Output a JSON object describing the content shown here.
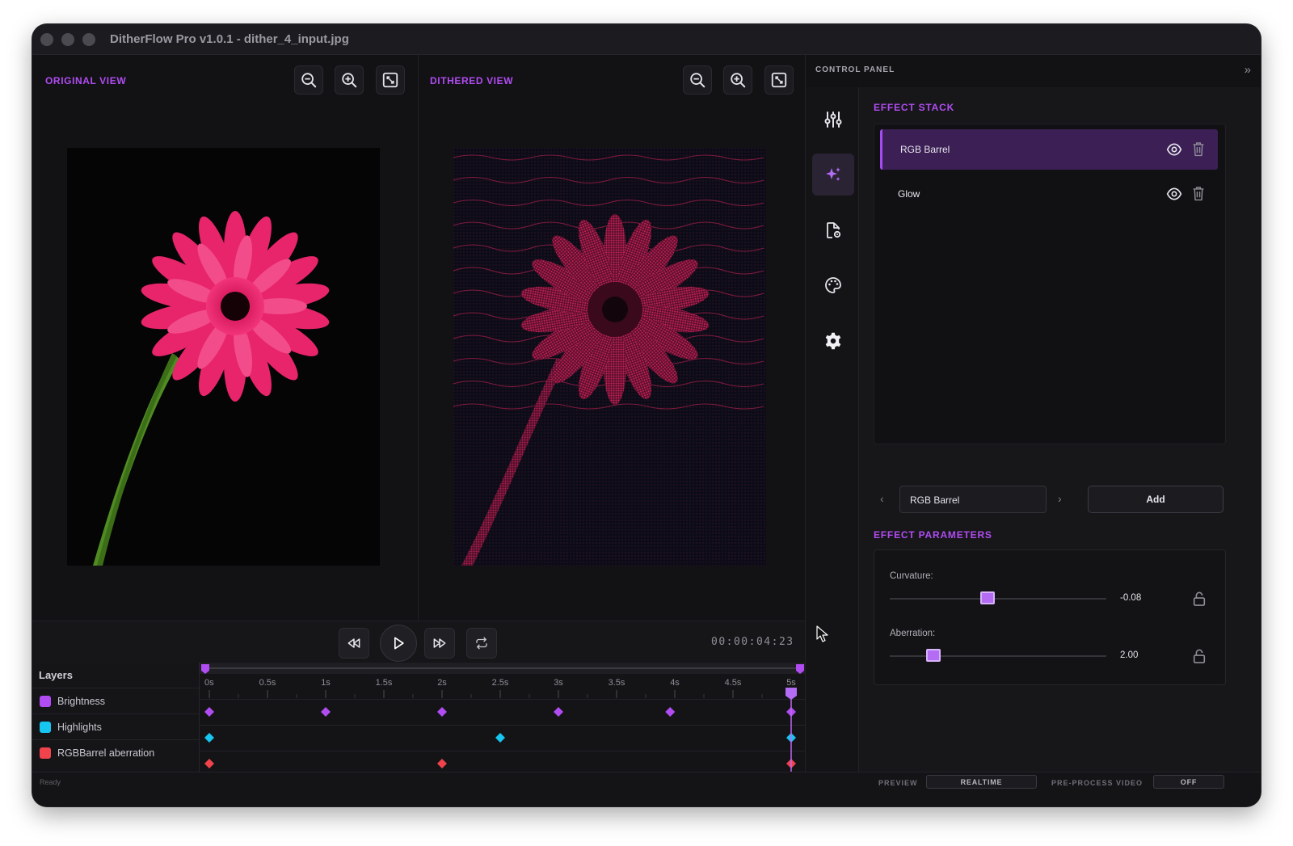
{
  "window": {
    "title": "DitherFlow Pro v1.0.1 - dither_4_input.jpg"
  },
  "views": {
    "original": {
      "title": "ORIGINAL VIEW"
    },
    "dithered": {
      "title": "DITHERED VIEW"
    }
  },
  "transport": {
    "timecode": "00:00:04:23"
  },
  "layers": {
    "title": "Layers",
    "items": [
      {
        "label": "Brightness",
        "color": "#b14cf2"
      },
      {
        "label": "Highlights",
        "color": "#17c6f0"
      },
      {
        "label": "RGBBarrel aberration",
        "color": "#f0434c"
      }
    ]
  },
  "timeline": {
    "ticks": [
      "0s",
      "0.5s",
      "1s",
      "1.5s",
      "2s",
      "2.5s",
      "3s",
      "3.5s",
      "4s",
      "4.5s",
      "5s"
    ],
    "playhead_time_s": 5,
    "keyframes": [
      {
        "layer": "Brightness",
        "times_s": [
          0,
          1,
          2,
          3,
          3.96,
          5
        ]
      },
      {
        "layer": "Highlights",
        "times_s": [
          0,
          2.5,
          5
        ]
      },
      {
        "layer": "RGBBarrel aberration",
        "times_s": [
          0,
          2,
          5
        ]
      }
    ]
  },
  "control_panel": {
    "title": "CONTROL PANEL",
    "effect_stack_title": "EFFECT STACK",
    "stack": [
      {
        "label": "RGB Barrel",
        "selected": true
      },
      {
        "label": "Glow",
        "selected": false
      }
    ],
    "picker": {
      "value": "RGB Barrel",
      "add_label": "Add"
    },
    "params_title": "EFFECT PARAMETERS",
    "params": [
      {
        "label": "Curvature:",
        "value": "-0.08",
        "position": 0.45
      },
      {
        "label": "Aberration:",
        "value": "2.00",
        "position": 0.2
      }
    ]
  },
  "status": {
    "ready": "Ready",
    "preview_label": "PREVIEW",
    "preview_value": "REALTIME",
    "preprocess_label": "PRE-PROCESS VIDEO",
    "preprocess_value": "OFF"
  },
  "accent_color": "#b14cf2"
}
